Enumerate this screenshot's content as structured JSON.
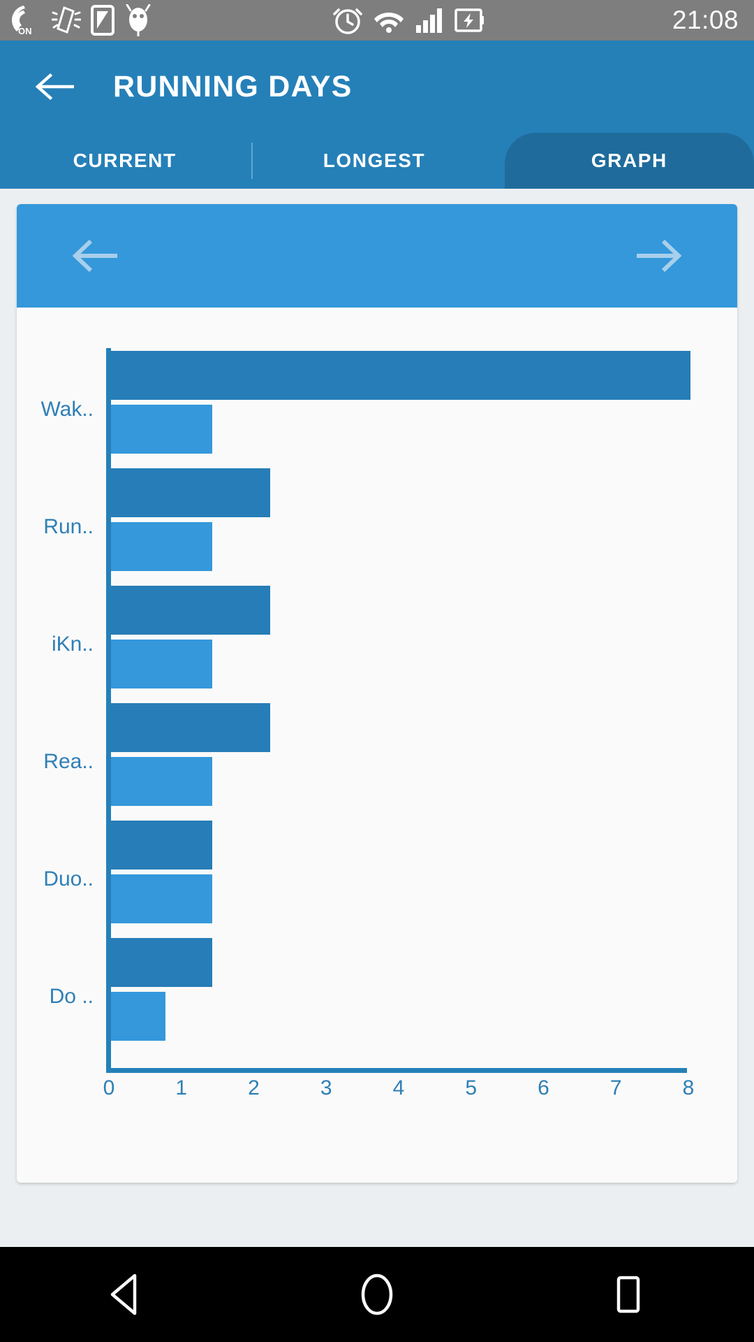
{
  "status_bar": {
    "icons_left": [
      "vibrate-on-icon",
      "shake-gesture-icon",
      "sim-card-icon",
      "android-debug-icon"
    ],
    "icons_right": [
      "alarm-clock-icon",
      "wifi-icon",
      "signal-bars-icon",
      "battery-charging-icon"
    ],
    "clock": "21:08"
  },
  "appbar": {
    "back_icon": "back-arrow-icon",
    "title": "RUNNING DAYS",
    "tabs": [
      {
        "label": "CURRENT",
        "selected": false
      },
      {
        "label": "LONGEST",
        "selected": false
      },
      {
        "label": "GRAPH",
        "selected": true
      }
    ]
  },
  "card": {
    "prev_icon": "left-arrow-icon",
    "next_icon": "right-arrow-icon"
  },
  "chart_data": {
    "type": "bar",
    "orientation": "horizontal",
    "title": "",
    "xlabel": "",
    "ylabel": "",
    "xlim": [
      0,
      8
    ],
    "ylim": null,
    "grid": false,
    "legend": "none",
    "xticks": [
      "0",
      "1",
      "2",
      "3",
      "4",
      "5",
      "6",
      "7",
      "8"
    ],
    "categories": [
      "Wak..",
      "Run..",
      "iKn..",
      "Rea..",
      "Duo..",
      "Do .."
    ],
    "series": [
      {
        "name": "longest",
        "color": "#267db7",
        "values": [
          8,
          2.2,
          2.2,
          2.2,
          1.4,
          1.4
        ]
      },
      {
        "name": "current",
        "color": "#3498db",
        "values": [
          1.4,
          1.4,
          1.4,
          1.4,
          1.4,
          0.75
        ]
      }
    ]
  },
  "navbar": {
    "back_icon": "triangle-back-icon",
    "home_icon": "circle-home-icon",
    "recents_icon": "square-recents-icon"
  },
  "colors": {
    "appbar": "#2580b8",
    "tab_selected": "#1f6c9c",
    "card_nav": "#3498db",
    "bar_dark": "#267db7",
    "bar_light": "#3498db",
    "axis": "#2580b8",
    "axis_text": "#2f7fb5",
    "page_bg": "#eceff1",
    "card_bg": "#fafafa",
    "status_bar": "#7e7e7e",
    "navbar": "#000000"
  }
}
